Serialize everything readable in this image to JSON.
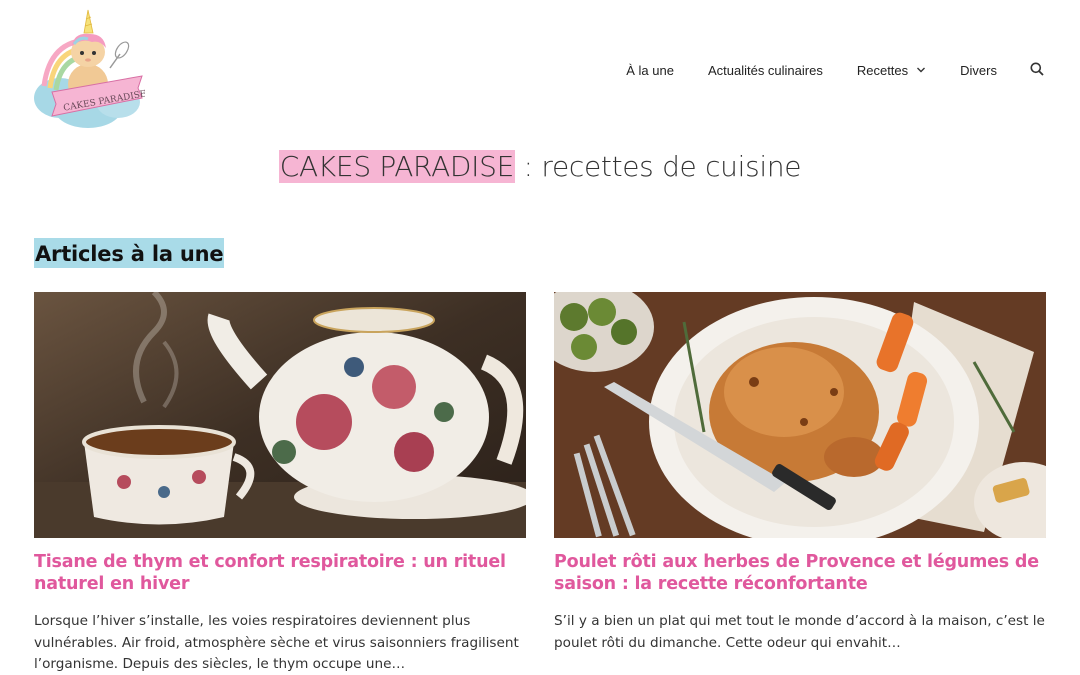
{
  "header": {
    "logo_text": "CAKES PARADISE",
    "nav": [
      {
        "label": "À la une"
      },
      {
        "label": "Actualités culinaires"
      },
      {
        "label": "Recettes"
      },
      {
        "label": "Divers"
      }
    ]
  },
  "site_title": {
    "highlight": "CAKES PARADISE",
    "rest": " : recettes de cuisine"
  },
  "section": {
    "heading": "Articles à la une"
  },
  "articles": [
    {
      "title": "Tisane de thym et confort respiratoire : un rituel naturel en hiver",
      "excerpt": "Lorsque l’hiver s’installe, les voies respiratoires deviennent plus vulnérables. Air froid, atmosphère sèche et virus saisonniers fragilisent l’organisme. Depuis des siècles, le thym occupe une…"
    },
    {
      "title": "Poulet rôti aux herbes de Provence et légumes de saison : la recette réconfortante",
      "excerpt": "S’il y a bien un plat qui met tout le monde d’accord à la maison, c’est le poulet rôti du dimanche. Cette odeur qui envahit…"
    }
  ],
  "colors": {
    "title_highlight": "#f6b5d3",
    "heading_highlight": "#a9dbe8",
    "article_title": "#e0589d"
  },
  "icons": {
    "nav_dropdown": "chevron-down-icon",
    "nav_search": "search-icon"
  }
}
